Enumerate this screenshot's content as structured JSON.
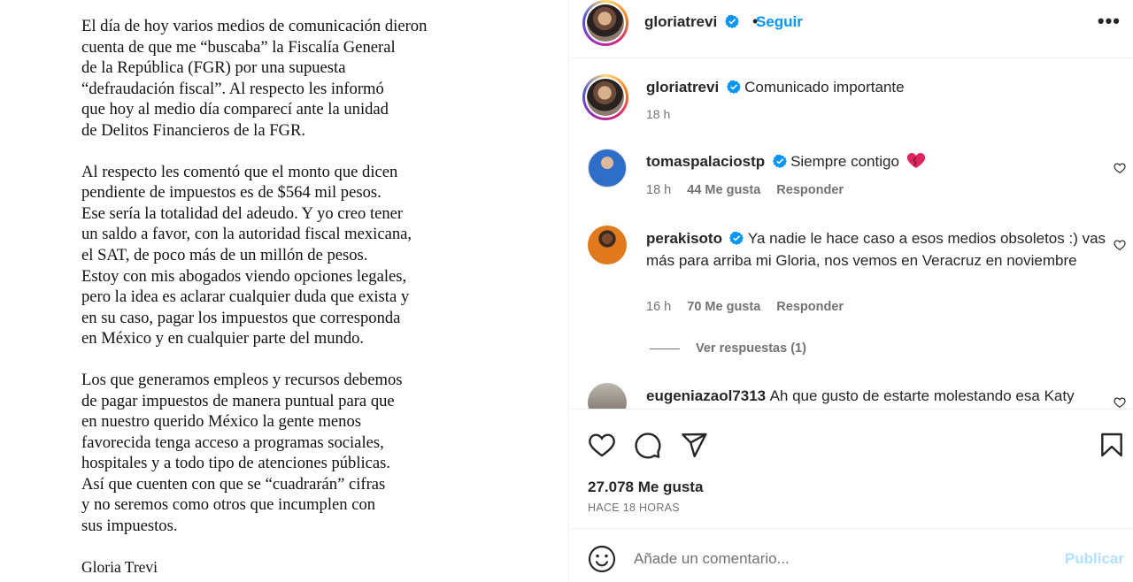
{
  "letter": {
    "paragraphs": [
      "El día de hoy varios medios de comunicación dieron\n cuenta de que me “buscaba” la Fiscalía General\nde la República (FGR) por una supuesta\n“defraudación fiscal”. Al respecto les informó\nque hoy al medio día comparecí ante la unidad\nde Delitos Financieros de la FGR.",
      "Al respecto les comentó que el monto que dicen\npendiente de impuestos es de $564 mil pesos.\nEse sería la totalidad del adeudo. Y yo creo tener\nun saldo a favor, con la autoridad fiscal mexicana,\n el SAT, de poco más de un millón de pesos.\nEstoy con mis abogados viendo opciones legales,\npero la idea es aclarar cualquier duda que exista y\nen su caso, pagar los impuestos que corresponda\nen México y en cualquier parte del mundo.",
      "Los que generamos empleos y recursos debemos\nde pagar impuestos de manera puntual para que\nen nuestro querido México la gente menos\nfavorecida tenga acceso a programas sociales,\nhospitales y a todo tipo de atenciones públicas.\nAsí que cuenten con que se “cuadrarán” cifras\ny no seremos como otros que incumplen con\nsus impuestos."
    ],
    "signature": "Gloria Trevi"
  },
  "header": {
    "username": "gloriatrevi",
    "separator": "•",
    "follow_label": "Seguir",
    "more_label": "•••"
  },
  "caption": {
    "username": "gloriatrevi",
    "text": "Comunicado importante",
    "time": "18 h"
  },
  "comments": [
    {
      "username": "tomaspalaciostp",
      "text": "Siempre contigo",
      "time": "18 h",
      "likes": "44 Me gusta",
      "reply": "Responder"
    },
    {
      "username": "perakisoto",
      "text": "Ya nadie le hace caso a esos medios obsoletos :) vas más para arriba mi Gloria, nos vemos en Veracruz en noviembre",
      "time": "16 h",
      "likes": "70 Me gusta",
      "reply": "Responder"
    },
    {
      "username": "eugeniazaol7313",
      "text": "Ah que gusto de estarte molestando esa Katy"
    }
  ],
  "view_replies": "Ver respuestas (1)",
  "actions": {
    "likes": "27.078 Me gusta",
    "ago": "HACE 18 HORAS"
  },
  "add_comment": {
    "placeholder": "Añade un comentario...",
    "publish": "Publicar"
  },
  "colors": {
    "accent": "#0095f6",
    "verified": "#0095f6",
    "secondary_text": "#737373",
    "publish_disabled": "#b2dffc",
    "heart_red": "#e0245e"
  },
  "icons": [
    "verified-badge-icon",
    "more-options-icon",
    "heart-icon",
    "comment-icon",
    "share-icon",
    "bookmark-icon",
    "emoji-icon",
    "red-heart-emoji-icon"
  ]
}
